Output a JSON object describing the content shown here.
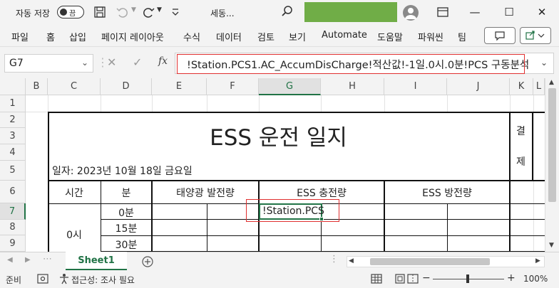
{
  "titlebar": {
    "autosave_label": "자동 저장",
    "toggle_state": "끔",
    "filename": "세동...",
    "search_value": ""
  },
  "ribbon": {
    "tabs": [
      "파일",
      "홈",
      "삽입",
      "페이지 레이아웃",
      "수식",
      "데이터",
      "검토",
      "보기",
      "Automate",
      "도움말",
      "파워씬",
      "팀"
    ]
  },
  "formula_bar": {
    "name_box": "G7",
    "fx_label": "fx",
    "formula": "!Station.PCS1.AC_AccumDisCharge!적산값!-1일.0시.0분!PCS 구동분석"
  },
  "grid": {
    "columns": [
      "B",
      "C",
      "D",
      "E",
      "F",
      "G",
      "H",
      "I",
      "J",
      "K",
      "L"
    ],
    "rows": [
      "1",
      "2",
      "3",
      "4",
      "5",
      "6",
      "7",
      "8",
      "9"
    ],
    "selected_column": "G",
    "selected_row": "7",
    "title": "ESS 운전 일지",
    "date_text": "일자: 2023년 10월 18일 금요일",
    "approval_1": "결",
    "approval_2": "제",
    "header_time": "시간",
    "header_minute": "분",
    "header_solar": "태양광 발전량",
    "header_charge": "ESS 충전량",
    "header_discharge": "ESS 방전량",
    "hour_label": "0시",
    "minutes": [
      "0분",
      "15분",
      "30분"
    ],
    "active_cell_value": "!Station.PCS"
  },
  "sheets": {
    "tabs": [
      "Sheet1"
    ],
    "active": "Sheet1"
  },
  "status_bar": {
    "ready": "준비",
    "accessibility": "접근성: 조사 필요",
    "zoom": "100%",
    "zoom_level": 1.0
  },
  "colors": {
    "excel_green": "#217346",
    "search_green": "#70ad47",
    "highlight_red": "#e03030"
  }
}
